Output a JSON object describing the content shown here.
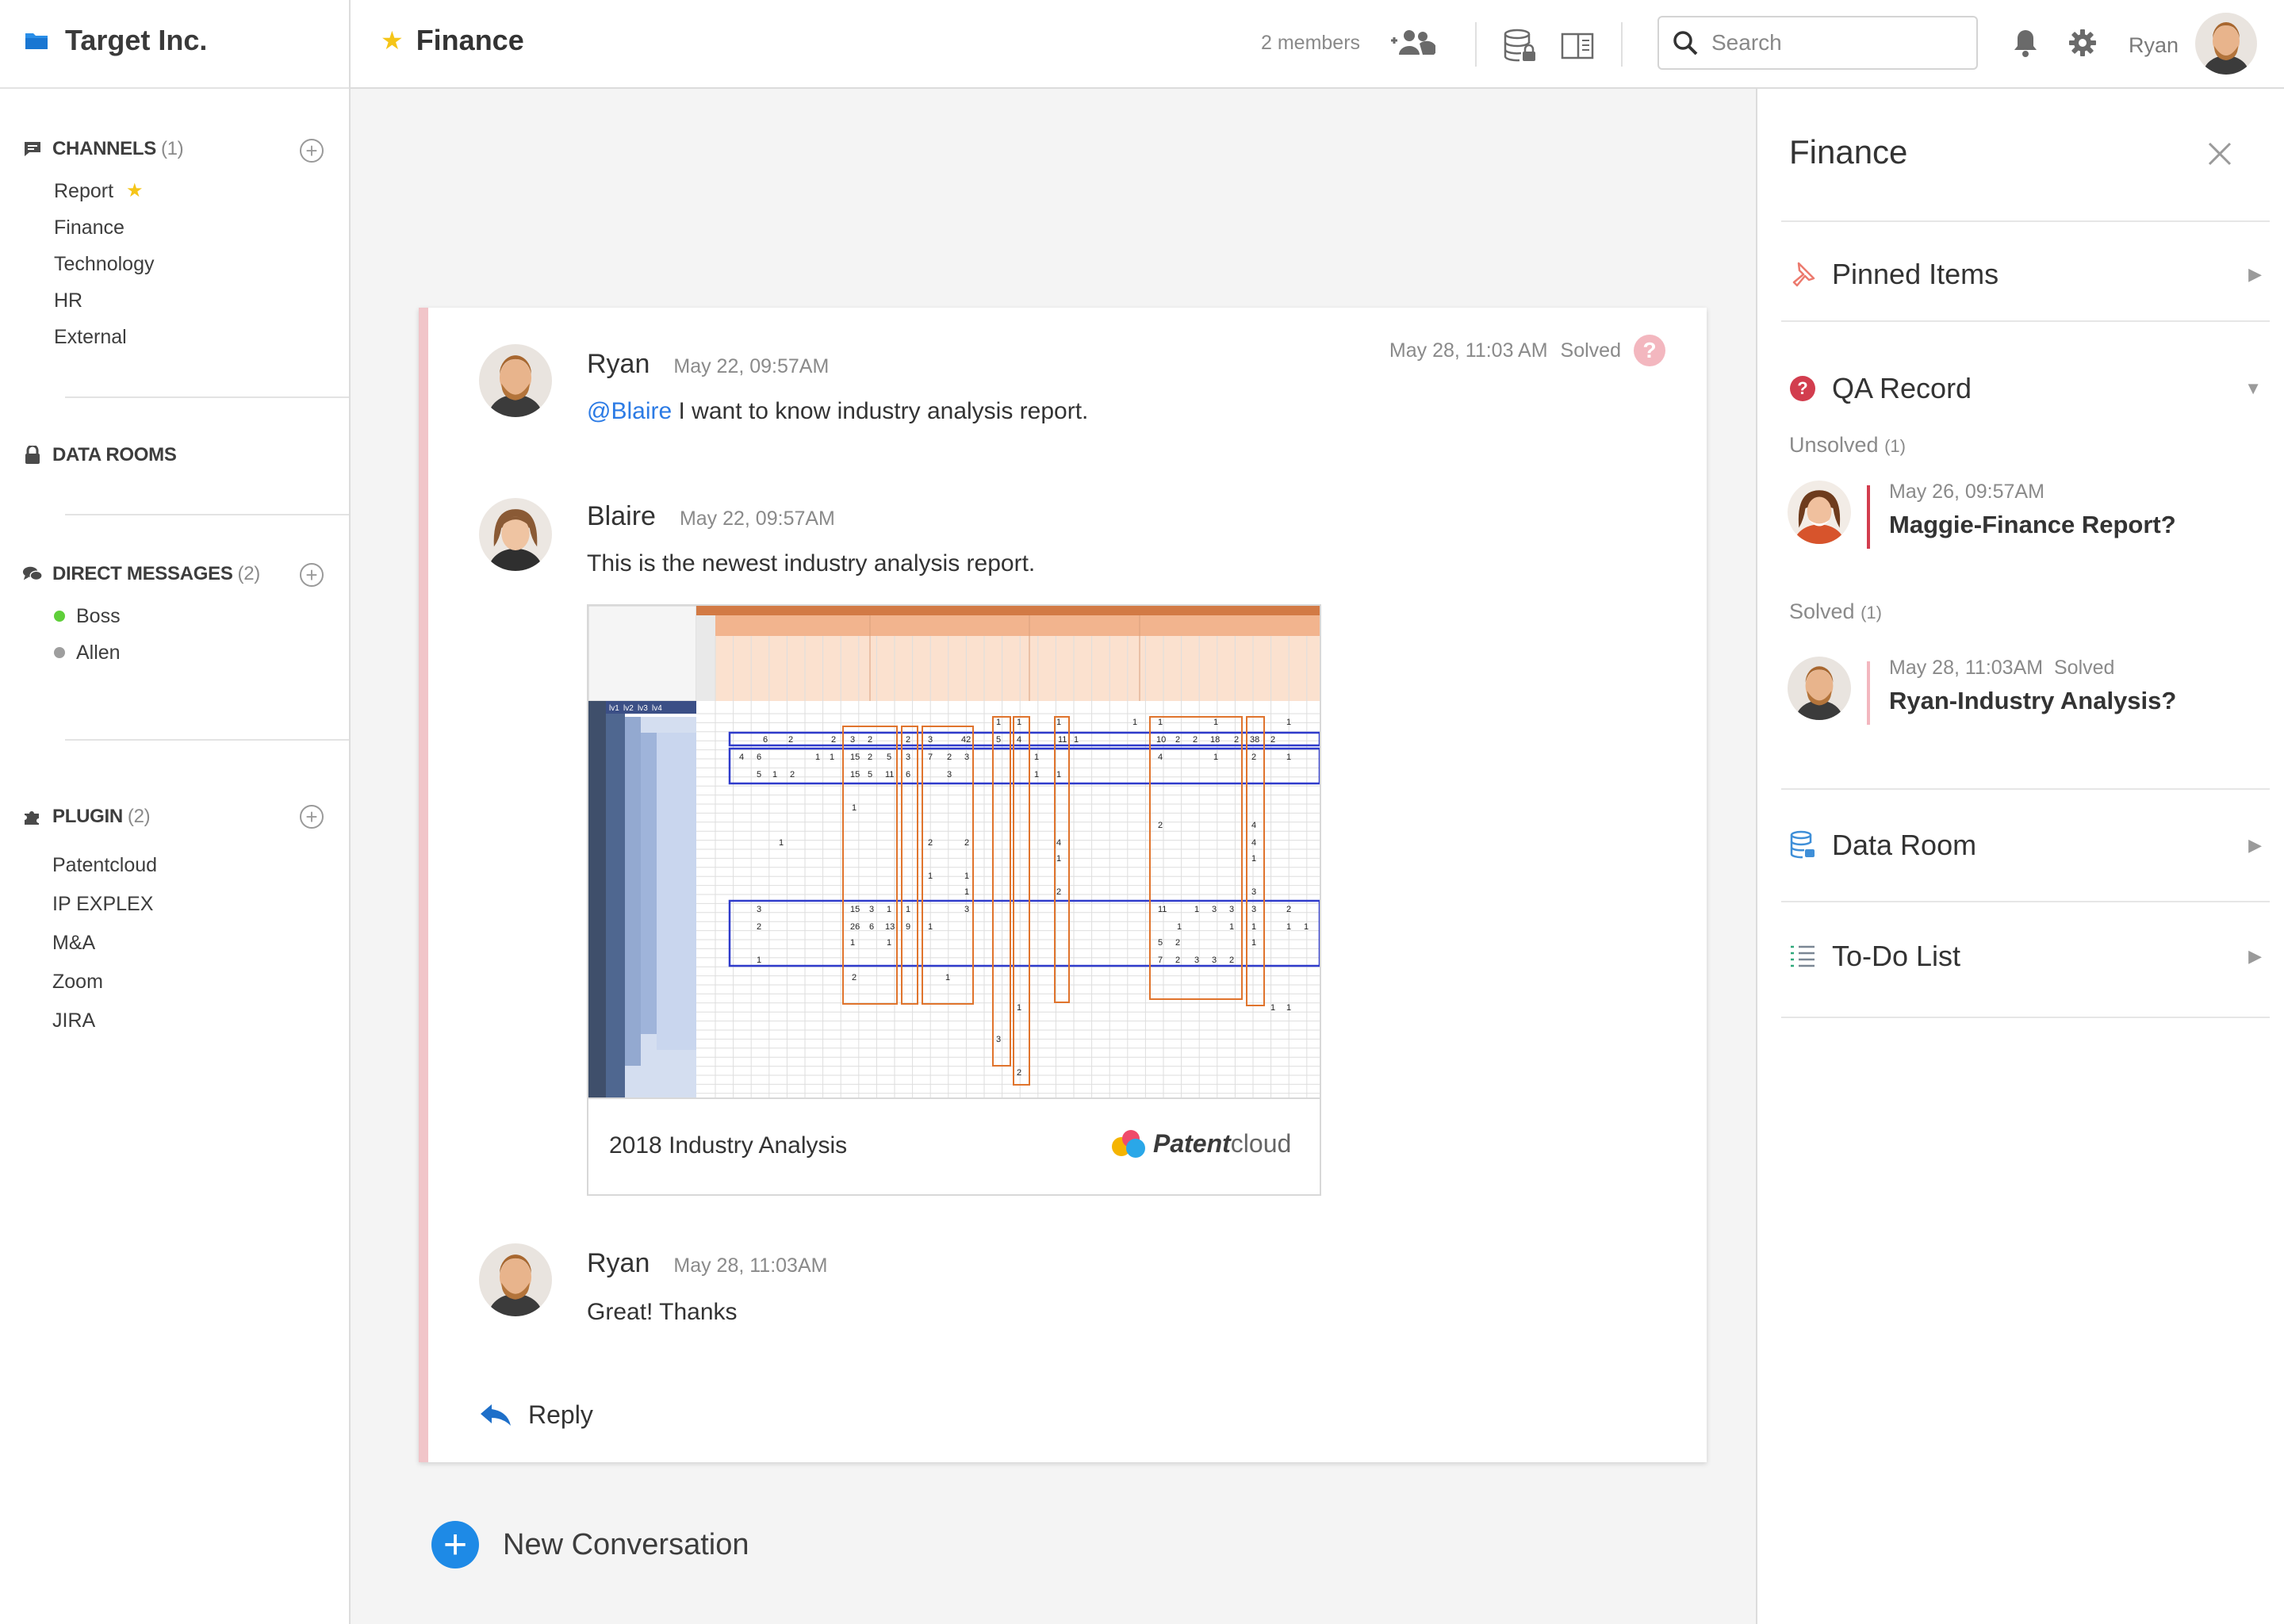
{
  "workspace": {
    "name": "Target Inc."
  },
  "header": {
    "channel_title": "Finance",
    "members": "2 members",
    "search_placeholder": "Search",
    "user_name": "Ryan"
  },
  "sidebar": {
    "channels": {
      "label": "CHANNELS",
      "count": "(1)",
      "items": [
        {
          "label": "Report",
          "starred": true
        },
        {
          "label": "Finance"
        },
        {
          "label": "Technology"
        },
        {
          "label": "HR"
        },
        {
          "label": "External"
        }
      ]
    },
    "data_rooms": {
      "label": "DATA ROOMS"
    },
    "direct_messages": {
      "label": "DIRECT MESSAGES",
      "count": "(2)",
      "items": [
        {
          "label": "Boss",
          "status_color": "#5fcf3a"
        },
        {
          "label": "Allen",
          "status_color": "#9e9e9e"
        }
      ]
    },
    "plugin": {
      "label": "PLUGIN",
      "count": "(2)",
      "items": [
        {
          "label": "Patentcloud"
        },
        {
          "label": "IP EXPLEX"
        },
        {
          "label": "M&A"
        },
        {
          "label": "Zoom"
        },
        {
          "label": "JIRA"
        }
      ]
    }
  },
  "thread": {
    "status_time": "May 28, 11:03 AM",
    "status": "Solved",
    "messages": [
      {
        "author": "Ryan",
        "time": "May 22, 09:57AM",
        "mention": "@Blaire",
        "text": " I want to know industry analysis report."
      },
      {
        "author": "Blaire",
        "time": "May 22, 09:57AM",
        "text": "This is the newest industry analysis report."
      },
      {
        "author": "Ryan",
        "time": "May 28, 11:03AM",
        "text": "Great! Thanks"
      }
    ],
    "attachment": {
      "title": "2018 Industry Analysis",
      "brand_bold": "Patent",
      "brand_light": "cloud",
      "level_tabs": [
        "lv1",
        "lv2",
        "lv3",
        "lv4"
      ]
    },
    "reply_label": "Reply"
  },
  "new_conversation": "New Conversation",
  "panel": {
    "title": "Finance",
    "pinned": "Pinned Items",
    "qa": {
      "label": "QA Record",
      "unsolved_label": "Unsolved",
      "unsolved_count": "(1)",
      "solved_label": "Solved",
      "solved_count": "(1)",
      "unsolved_items": [
        {
          "time": "May 26, 09:57AM",
          "title": "Maggie-Finance Report?"
        }
      ],
      "solved_items": [
        {
          "time": "May 28, 11:03AM",
          "status": "Solved",
          "title": "Ryan-Industry Analysis?"
        }
      ]
    },
    "data_room": "Data Room",
    "todo": "To-Do List"
  },
  "colors": {
    "accent": "#1e8ae6",
    "star": "#f5c518",
    "thread_bar": "#f1c5c9",
    "unsolved_bar": "#d23d4e",
    "solved_bar": "#f3b7bf",
    "qa_icon": "#d23d4e"
  },
  "icons": {
    "brand": "folder-icon",
    "channels": "chat-bubble-icon",
    "data_rooms": "lock-icon",
    "direct_messages": "chat-bubbles-icon",
    "plugin": "puzzle-icon",
    "add": "plus-circle-icon",
    "members": "add-user-icon",
    "database": "database-lock-icon",
    "panel": "panel-toggle-icon",
    "search": "search-icon",
    "bell": "bell-icon",
    "settings": "gear-icon",
    "reply": "reply-arrow-icon",
    "pin": "pin-icon",
    "qa": "question-icon",
    "data_room": "database-icon",
    "todo": "checklist-icon"
  }
}
